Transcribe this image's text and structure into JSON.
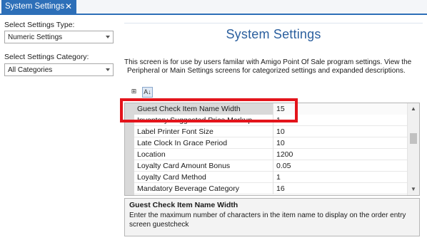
{
  "tab": {
    "label": "System Settings",
    "close_glyph": "✕"
  },
  "left": {
    "type_label": "Select Settings Type:",
    "type_value": "Numeric Settings",
    "category_label": "Select Settings Category:",
    "category_value": "All Categories"
  },
  "main": {
    "title": "System Settings",
    "description_line1": "This screen is for use by users familar with Amigo Point Of Sale program settings. View the",
    "description_line2": "Peripheral or Main Settings screens for categorized settings and expanded descriptions."
  },
  "toolbar": {
    "categorized_glyph": "⊞",
    "alphabetical_glyph": "A↓"
  },
  "grid": {
    "rows": [
      {
        "name": "Guest Check Item Name Width",
        "value": "15"
      },
      {
        "name": "Inventory Suggested Price Markup",
        "value": "1"
      },
      {
        "name": "Label Printer Font Size",
        "value": "10"
      },
      {
        "name": "Late Clock In Grace Period",
        "value": "10"
      },
      {
        "name": "Location",
        "value": "1200"
      },
      {
        "name": "Loyalty Card Amount Bonus",
        "value": "0.05"
      },
      {
        "name": "Loyalty Card Method",
        "value": "1"
      },
      {
        "name": "Mandatory Beverage Category",
        "value": "16"
      }
    ]
  },
  "help": {
    "title": "Guest Check Item Name Width",
    "text": "Enter the maximum number of characters in the item name to display on the order entry screen guestcheck"
  },
  "colors": {
    "accent": "#2d6fb8",
    "title": "#2b5f9e",
    "highlight": "#e3141b"
  }
}
